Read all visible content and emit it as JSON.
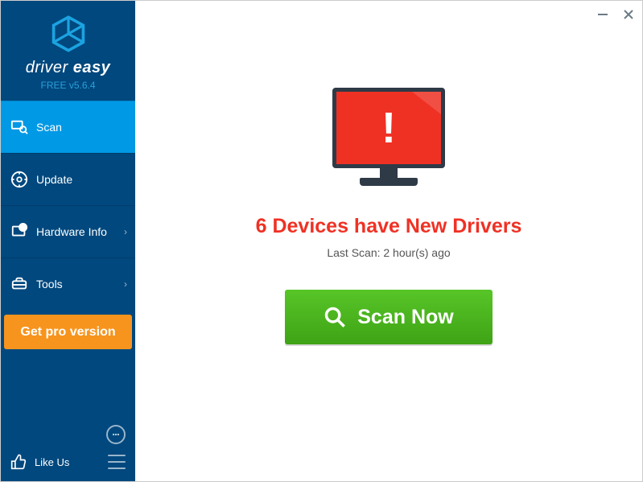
{
  "app": {
    "brand_line1": "driver",
    "brand_line2": "easy",
    "version": "FREE v5.6.4"
  },
  "sidebar": {
    "items": [
      {
        "label": "Scan"
      },
      {
        "label": "Update"
      },
      {
        "label": "Hardware Info"
      },
      {
        "label": "Tools"
      }
    ],
    "pro_label": "Get pro version",
    "like_label": "Like Us"
  },
  "main": {
    "headline": "6 Devices have New Drivers",
    "last_scan": "Last Scan: 2 hour(s) ago",
    "scan_button": "Scan Now"
  },
  "colors": {
    "sidebar_bg": "#00487e",
    "active_bg": "#0099e5",
    "pro_bg": "#f7941d",
    "alert_red": "#ef3124",
    "scan_green": "#4caf1f"
  }
}
